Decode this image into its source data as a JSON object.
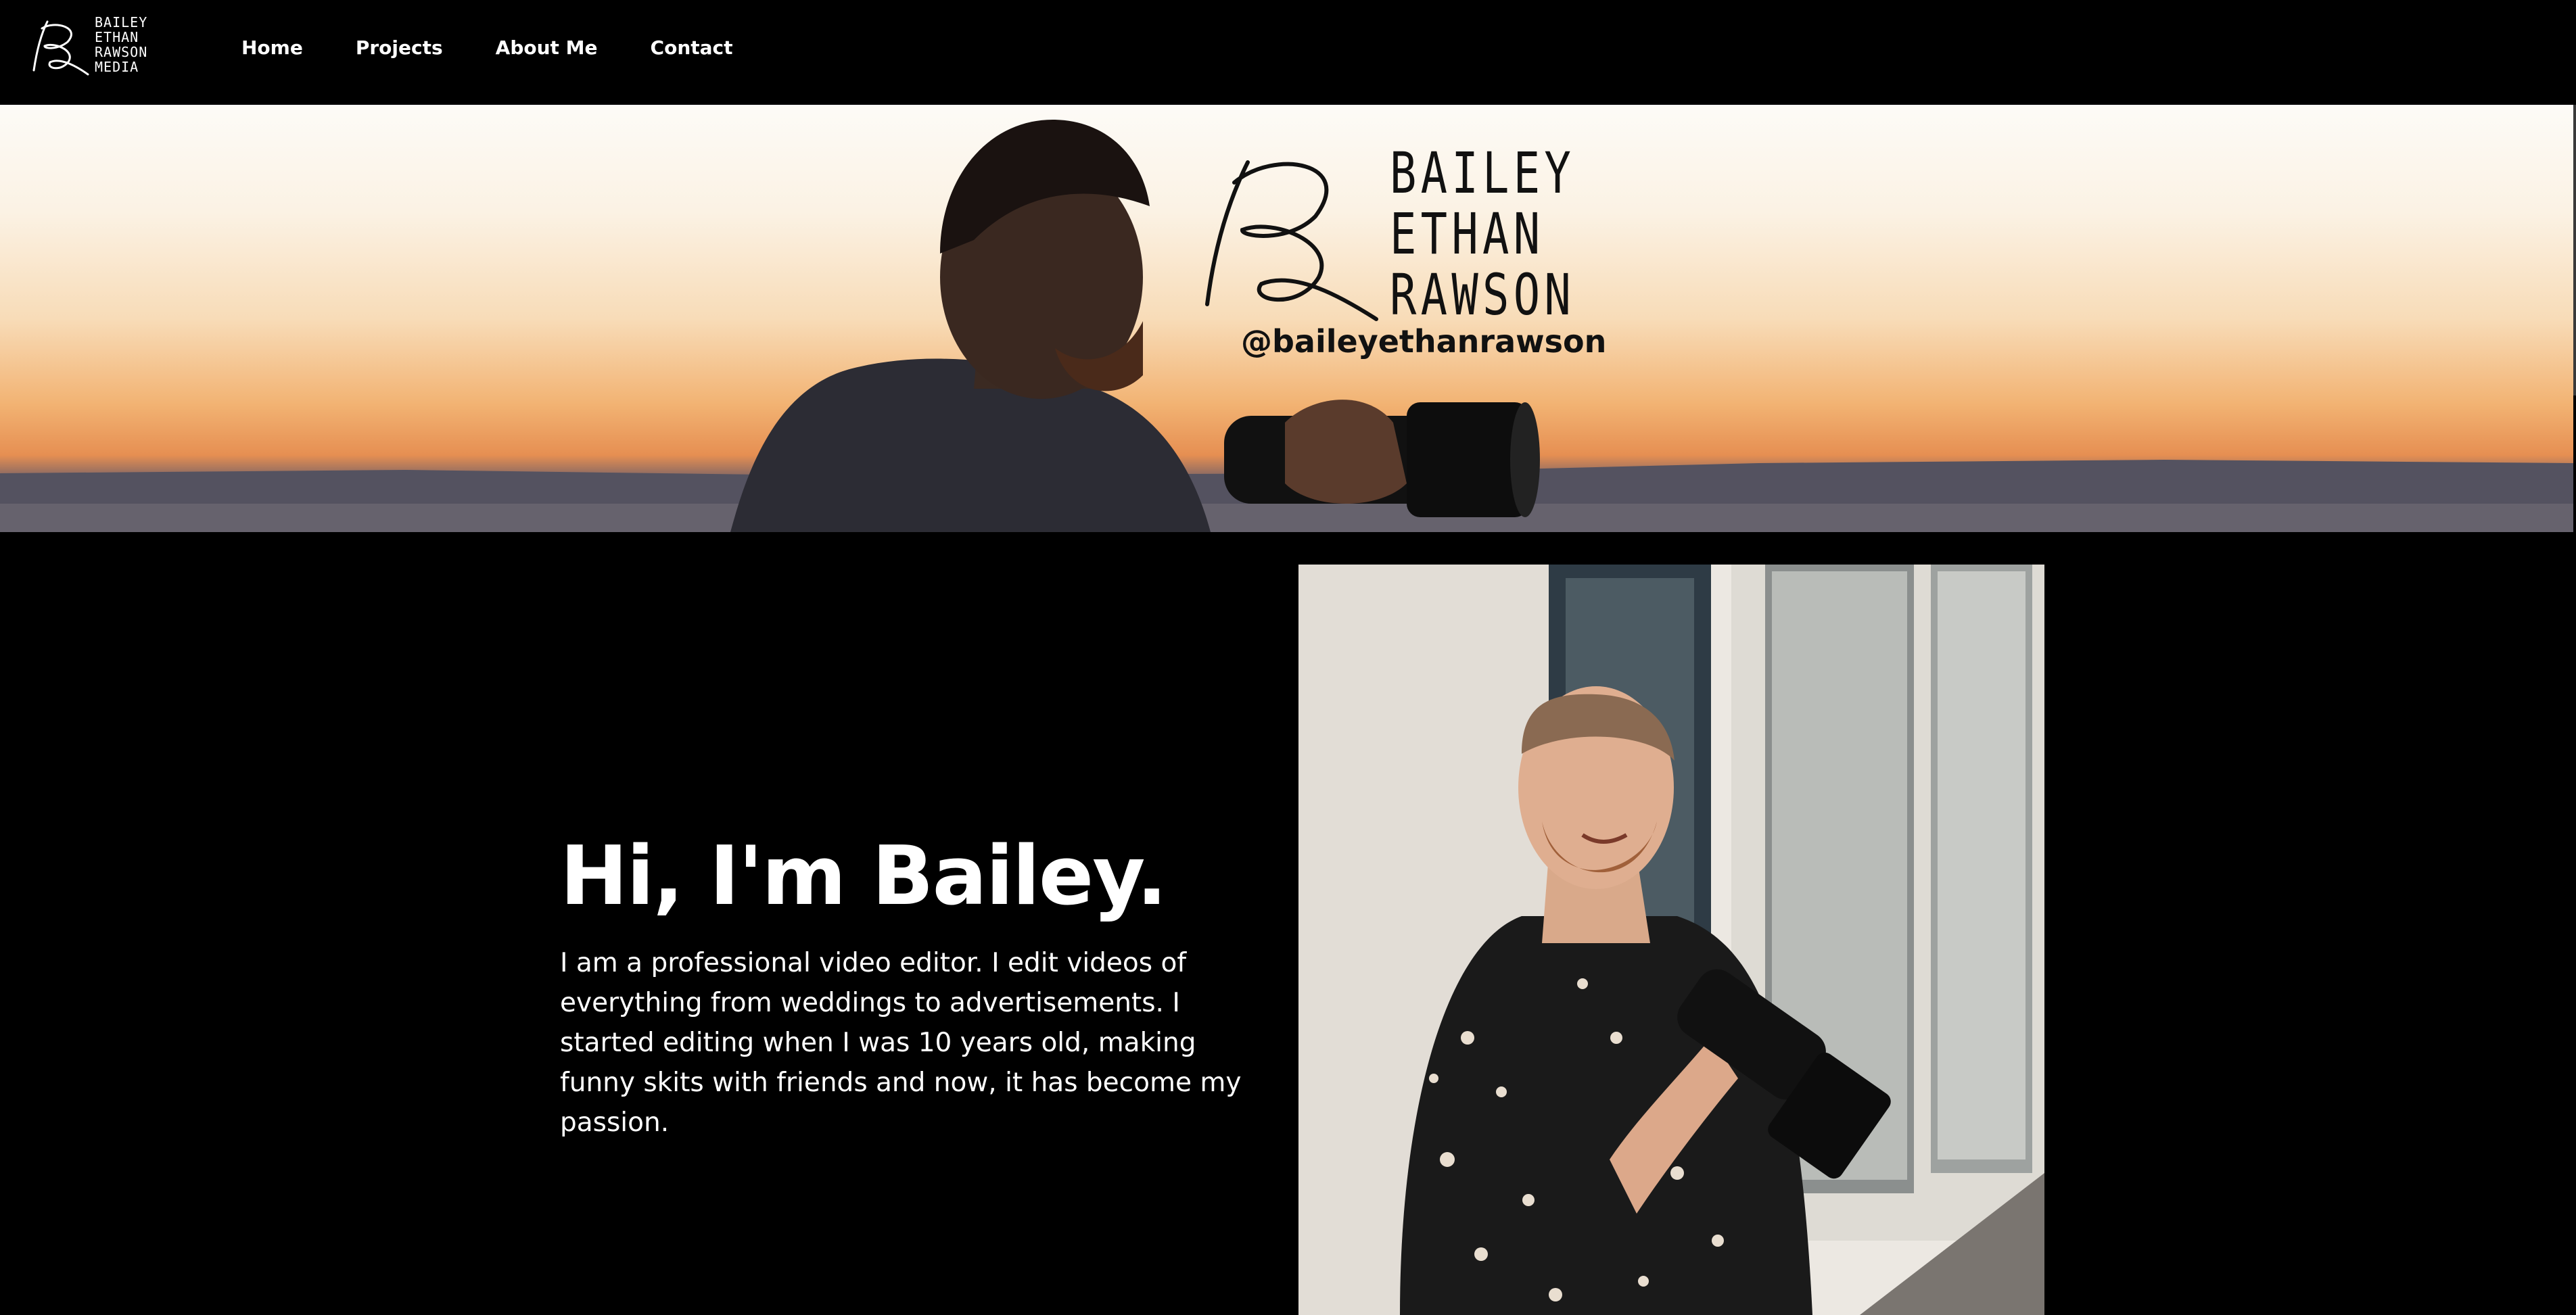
{
  "header": {
    "logo": {
      "lines": [
        "BAILEY",
        "ETHAN",
        "RAWSON",
        "MEDIA"
      ]
    },
    "nav": [
      {
        "label": "Home"
      },
      {
        "label": "Projects"
      },
      {
        "label": "About Me"
      },
      {
        "label": "Contact"
      }
    ]
  },
  "banner": {
    "brand_lines": [
      "BAILEY",
      "ETHAN",
      "RAWSON"
    ],
    "handle": "@baileyethanrawson"
  },
  "intro": {
    "headline": "Hi, I'm Bailey.",
    "bio": "I am a professional video editor. I edit videos of everything from weddings to advertisements. I started editing when I was 10 years old, making funny skits with friends and now, it has become my passion."
  },
  "colors": {
    "page_background": "#000000",
    "text": "#ffffff",
    "banner_sky_top": "#fdfbf7",
    "banner_sunset": "#e68f52"
  }
}
